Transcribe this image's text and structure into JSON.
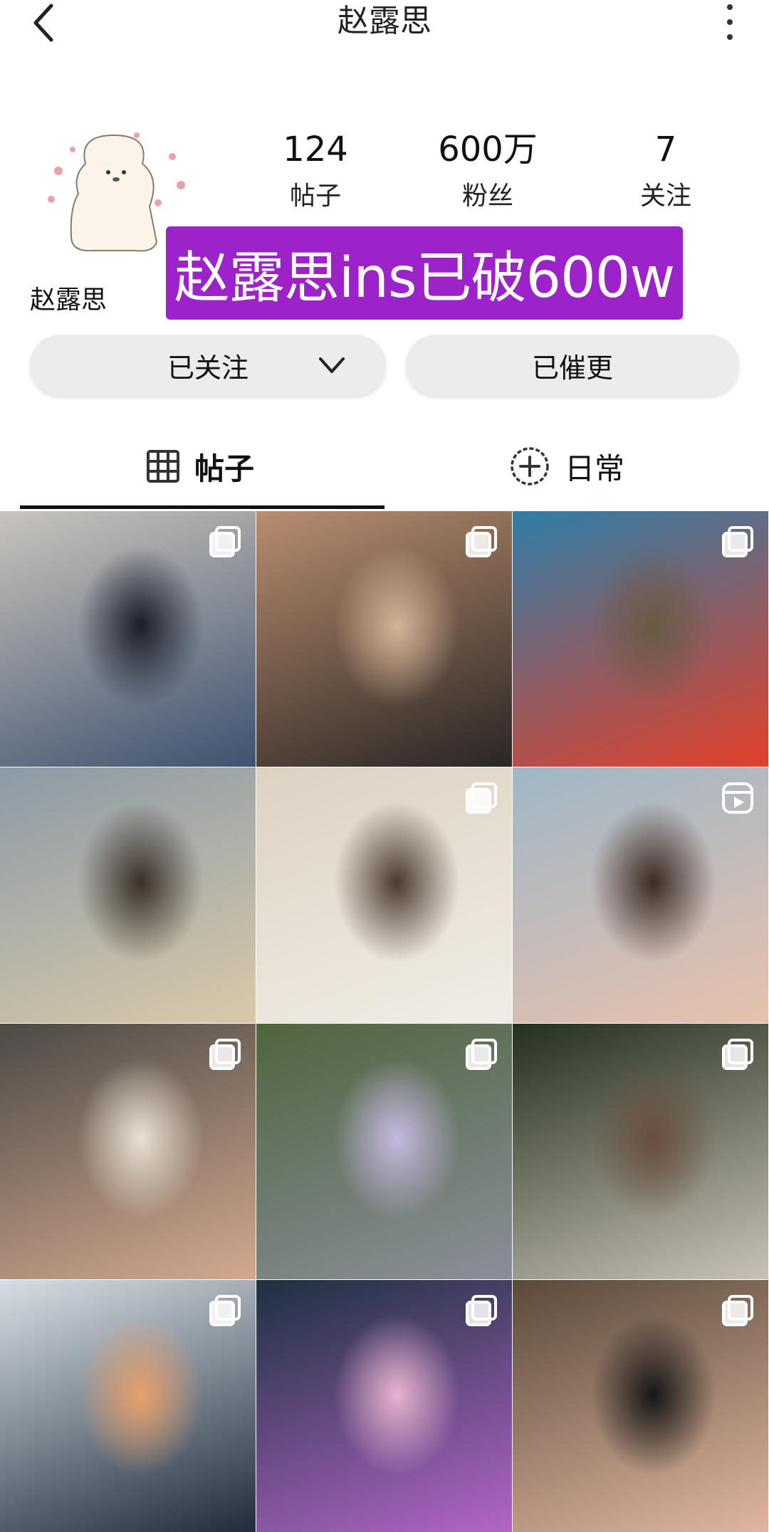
{
  "header": {
    "title": "赵露思"
  },
  "profile": {
    "name": "赵露思",
    "stats": [
      {
        "value": "124",
        "label": "帖子"
      },
      {
        "value": "600万",
        "label": "粉丝"
      },
      {
        "value": "7",
        "label": "关注"
      }
    ],
    "banner_text": "赵露思ins已破600w"
  },
  "actions": {
    "follow_label": "已关注",
    "urge_label": "已催更"
  },
  "tabs": [
    {
      "label": "帖子",
      "icon": "grid-icon",
      "active": true
    },
    {
      "label": "日常",
      "icon": "add-circle-icon",
      "active": false
    }
  ],
  "posts": [
    {
      "badge": "multi-photo",
      "colors": [
        "#c9c4bc",
        "#3e5270",
        "#1a1e2a"
      ]
    },
    {
      "badge": "multi-photo",
      "colors": [
        "#b88d6f",
        "#2a2624",
        "#d5b497"
      ]
    },
    {
      "badge": "multi-photo",
      "colors": [
        "#2f7ea8",
        "#e3402a",
        "#6a5a43"
      ]
    },
    {
      "badge": "none",
      "colors": [
        "#8b9aa6",
        "#d9c9a9",
        "#3a3028"
      ]
    },
    {
      "badge": "multi-photo",
      "colors": [
        "#dcd2c2",
        "#f1ede6",
        "#4a3a30"
      ]
    },
    {
      "badge": "reel",
      "colors": [
        "#9fb6c6",
        "#e7c1ad",
        "#3b2a22"
      ]
    },
    {
      "badge": "multi-photo",
      "colors": [
        "#4c4a46",
        "#d3a98f",
        "#e9e2d4"
      ]
    },
    {
      "badge": "multi-photo",
      "colors": [
        "#50653f",
        "#8a8f9a",
        "#c6b9e0"
      ]
    },
    {
      "badge": "multi-photo",
      "colors": [
        "#24301f",
        "#c9c2b6",
        "#6b4e3e"
      ]
    },
    {
      "badge": "multi-photo",
      "colors": [
        "#d7dfe5",
        "#1f2a3a",
        "#e8a06a"
      ]
    },
    {
      "badge": "multi-photo",
      "colors": [
        "#1c3140",
        "#b466c8",
        "#e8b4d0"
      ]
    },
    {
      "badge": "multi-photo",
      "colors": [
        "#5a4a3c",
        "#e1b7a0",
        "#161616"
      ]
    }
  ]
}
